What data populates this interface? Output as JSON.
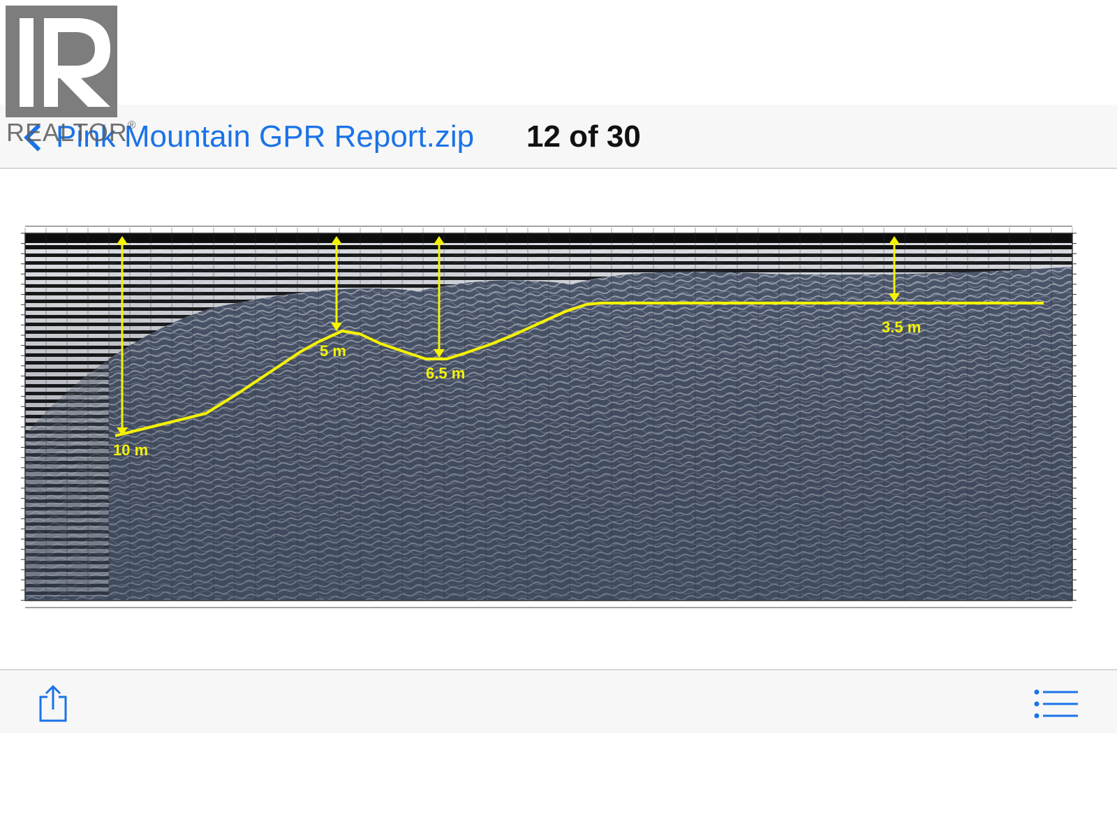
{
  "logo": {
    "text": "REALTOR",
    "mark": "®"
  },
  "nav": {
    "back_label": "Pink Mountain GPR Report.zip",
    "counter": "12 of 30"
  },
  "figure": {
    "annotations": [
      "10 m",
      "5 m",
      "6.5 m",
      "3.5 m"
    ],
    "colors": {
      "line": "#f5f300",
      "background": "#4e576b"
    }
  },
  "toolbar": {
    "share_icon": "share-icon",
    "list_icon": "list-icon"
  },
  "colors": {
    "accent": "#1a73e8"
  }
}
